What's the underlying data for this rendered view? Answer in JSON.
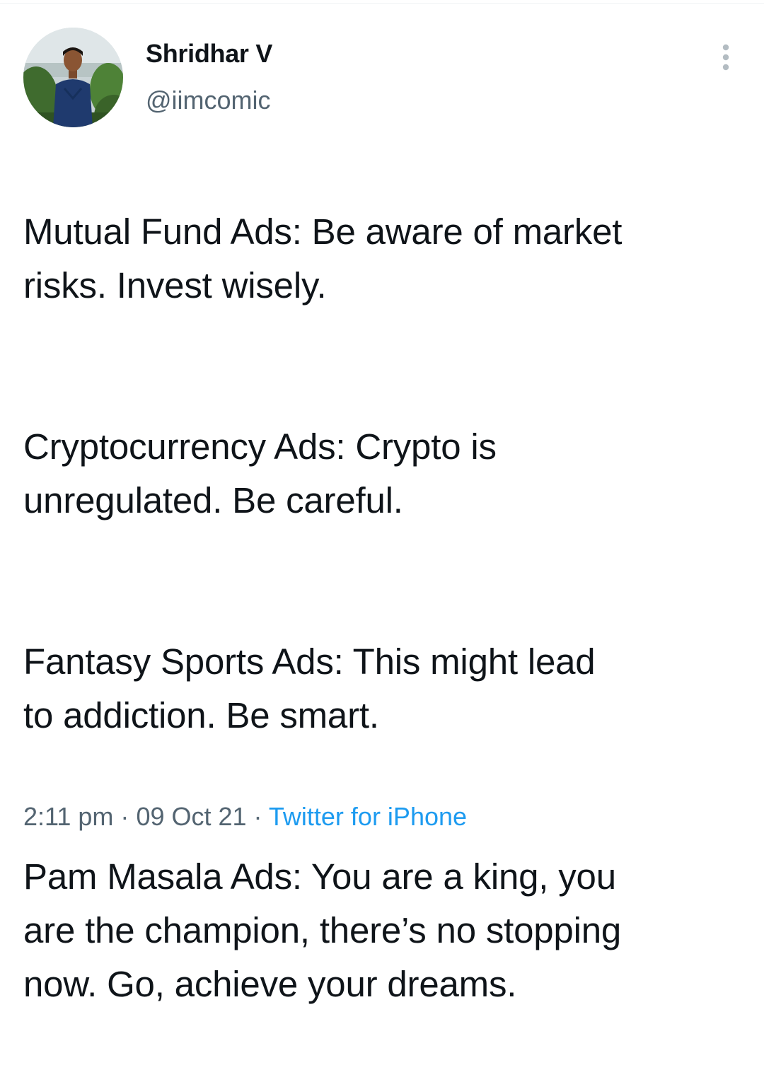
{
  "author": {
    "display_name": "Shridhar V",
    "handle": "@iimcomic"
  },
  "menu": {
    "icon": "more-vertical-icon"
  },
  "tweet": {
    "paragraphs": [
      "Mutual Fund Ads: Be aware of market\nrisks. Invest wisely.",
      "Cryptocurrency Ads: Crypto is\nunregulated. Be careful.",
      "Fantasy Sports Ads: This might lead\nto addiction. Be smart.",
      "Pam Masala Ads: You are a king, you\nare the champion, there’s no stopping\nnow. Go, achieve your dreams."
    ]
  },
  "meta": {
    "time": "2:11 pm",
    "separator": "·",
    "date": "09 Oct 21",
    "source": "Twitter for iPhone"
  },
  "colors": {
    "text": "#0f1419",
    "secondary": "#536471",
    "link": "#1d9bf0"
  }
}
